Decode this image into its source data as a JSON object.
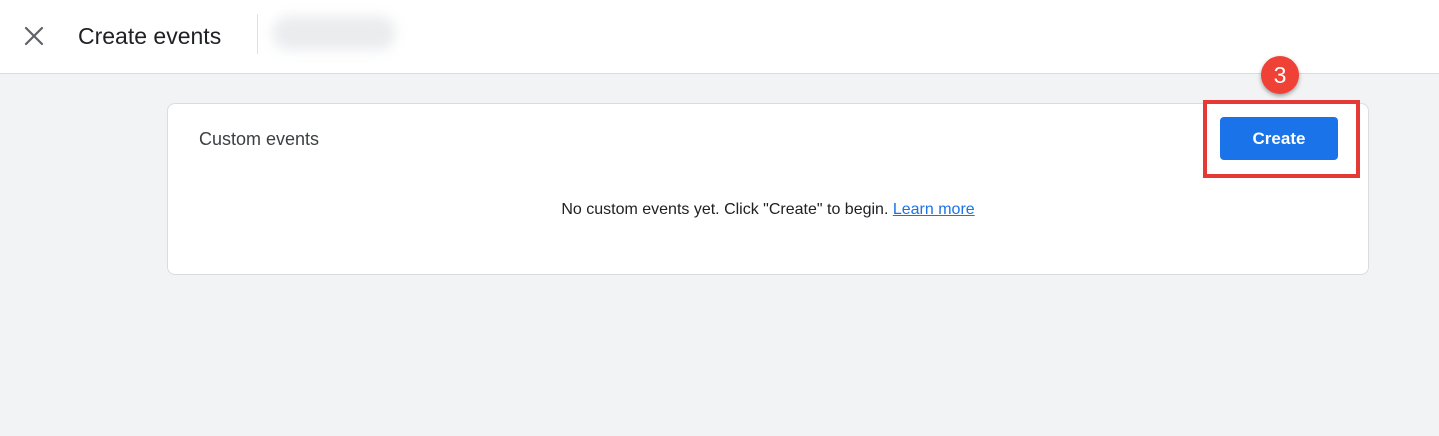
{
  "header": {
    "close_icon": "close-icon",
    "title": "Create events"
  },
  "card": {
    "title": "Custom events",
    "empty_message": "No custom events yet. Click \"Create\" to begin.",
    "learn_more_label": "Learn more",
    "create_label": "Create"
  },
  "annotation": {
    "step_number": "3",
    "highlight_color": "#e53935"
  },
  "colors": {
    "primary": "#1a73e8",
    "background": "#f1f3f4"
  }
}
